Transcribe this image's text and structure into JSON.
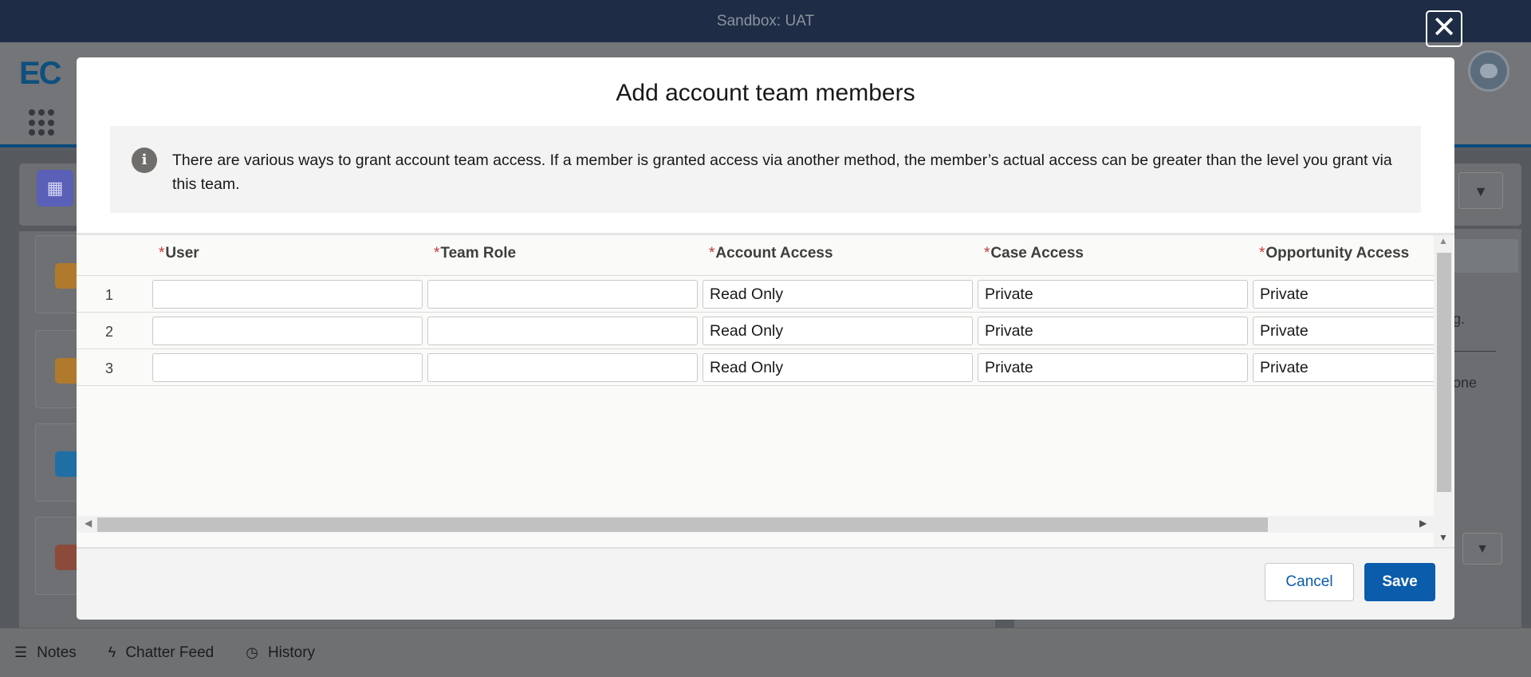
{
  "sandbox_banner": "Sandbox: UAT",
  "app": {
    "logo_text": "EC"
  },
  "modal": {
    "title": "Add account team members",
    "notice": "There are various ways to grant account team access. If a member is granted access via another method, the member’s actual access can be greater than the level you grant via this team.",
    "required_marker": "*",
    "columns": [
      "User",
      "Team Role",
      "Account Access",
      "Case Access",
      "Opportunity Access"
    ],
    "rows": [
      {
        "num": "1",
        "user": "",
        "team_role": "",
        "account_access": "Read Only",
        "case_access": "Private",
        "opportunity_access": "Private"
      },
      {
        "num": "2",
        "user": "",
        "team_role": "",
        "account_access": "Read Only",
        "case_access": "Private",
        "opportunity_access": "Private"
      },
      {
        "num": "3",
        "user": "",
        "team_role": "",
        "account_access": "Read Only",
        "case_access": "Private",
        "opportunity_access": "Private"
      }
    ],
    "buttons": {
      "cancel": "Cancel",
      "save": "Save"
    }
  },
  "background": {
    "right_text_1": "g.",
    "right_text_2": "one"
  },
  "utility_bar": [
    {
      "label": "Notes",
      "icon": "notes-icon"
    },
    {
      "label": "Chatter Feed",
      "icon": "bolt-icon"
    },
    {
      "label": "History",
      "icon": "clock-icon"
    }
  ],
  "colors": {
    "brand": "#0b5cab",
    "required": "#c23934",
    "sandbox_bar": "#1e2d45"
  }
}
